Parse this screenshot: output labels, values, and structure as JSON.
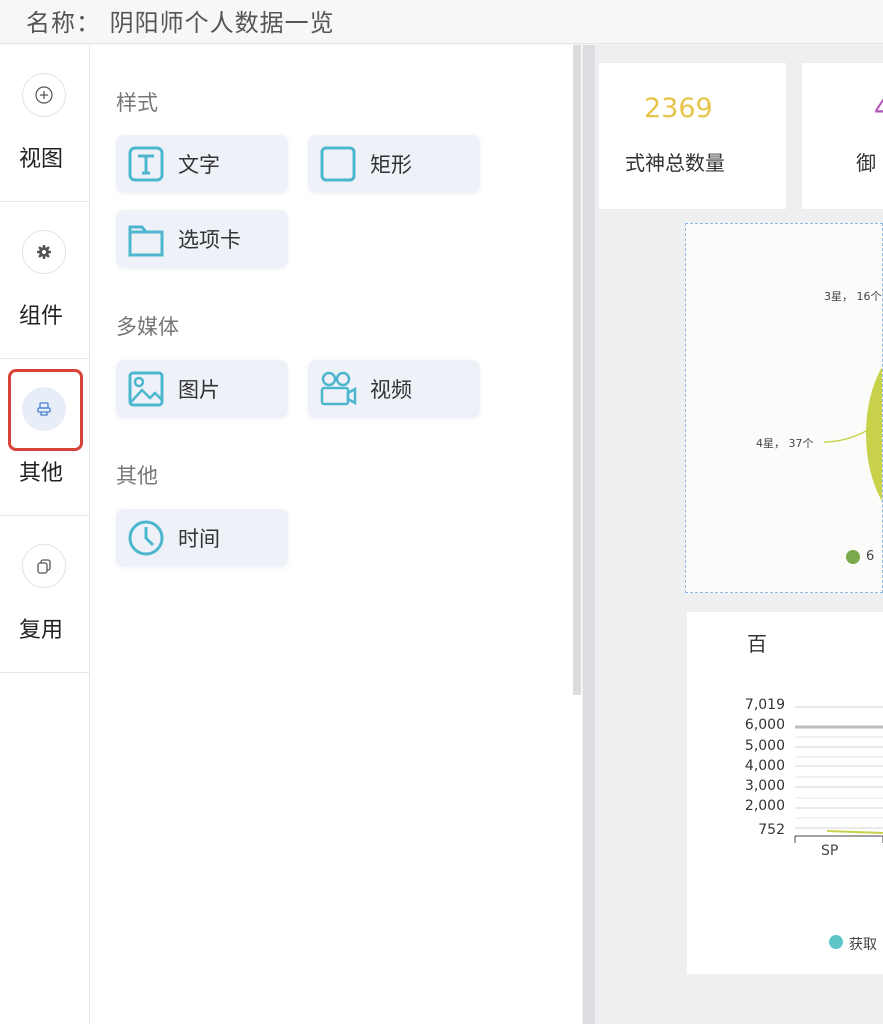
{
  "app": {
    "title": "名称： 阴阳师个人数据一览"
  },
  "rail": {
    "items": [
      {
        "label": "视图",
        "icon": "plus-circle-icon"
      },
      {
        "label": "组件",
        "icon": "gear-icon"
      },
      {
        "label": "其他",
        "icon": "stamp-icon",
        "active": true
      },
      {
        "label": "复用",
        "icon": "copy-icon"
      }
    ]
  },
  "panel": {
    "sections": [
      {
        "title": "样式",
        "items": [
          {
            "label": "文字",
            "icon": "text-icon"
          },
          {
            "label": "矩形",
            "icon": "rectangle-icon"
          },
          {
            "label": "选项卡",
            "icon": "tab-icon"
          }
        ]
      },
      {
        "title": "多媒体",
        "items": [
          {
            "label": "图片",
            "icon": "image-icon"
          },
          {
            "label": "视频",
            "icon": "video-icon"
          }
        ]
      },
      {
        "title": "其他",
        "items": [
          {
            "label": "时间",
            "icon": "clock-icon"
          }
        ]
      }
    ]
  },
  "canvas": {
    "stat1": {
      "value": "2369",
      "label": "式神总数量"
    },
    "stat2": {
      "value_partial": "4",
      "label_partial": "御"
    },
    "pie": {
      "label_3star": "3星， 16个",
      "label_4star": "4星， 37个",
      "legend_partial": "6"
    },
    "bar": {
      "title_partial": "百",
      "y_ticks": [
        "7,019",
        "6,000",
        "5,000",
        "4,000",
        "3,000",
        "2,000",
        "752"
      ],
      "x_first": "SP",
      "legend_partial": "获取"
    }
  },
  "colors": {
    "accent": "#5bc0d0",
    "stat_value": "#e8c44a",
    "active_outline": "#d9443a",
    "pie_green": "#c8d14a",
    "legend_green": "#7aa84a",
    "legend_teal": "#5ec6c8"
  }
}
